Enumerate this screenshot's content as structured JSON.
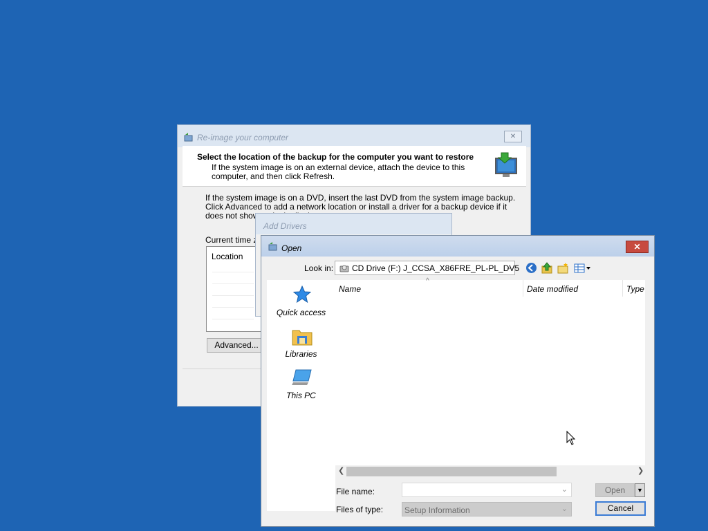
{
  "reimage": {
    "title": "Re-image your computer",
    "close_glyph": "✕",
    "header_title": "Select the location of the backup for the computer you want to restore",
    "header_sub": "If the system image is on an external device, attach the device to this computer, and then click Refresh.",
    "body_text": "If the system image is on a DVD, insert the last DVD from the system image backup. Click Advanced to add a network location or install a driver for a backup device if it does not show up in the list be",
    "time_zone_label": "Current time zo",
    "list_column": "Location",
    "advanced_button": "Advanced..."
  },
  "add_drivers": {
    "title": "Add Drivers"
  },
  "open_dialog": {
    "title": "Open",
    "close_glyph": "✕",
    "look_in_label": "Look in:",
    "look_in_value": "CD Drive (F:) J_CCSA_X86FRE_PL-PL_DV5",
    "places": [
      {
        "label": "Quick access",
        "icon": "star-icon"
      },
      {
        "label": "Libraries",
        "icon": "libraries-icon"
      },
      {
        "label": "This PC",
        "icon": "computer-icon"
      }
    ],
    "columns": [
      "Name",
      "Date modified",
      "Type"
    ],
    "file_name_label": "File name:",
    "file_name_value": "",
    "files_of_type_label": "Files of type:",
    "files_of_type_value": "Setup Information",
    "open_button": "Open",
    "cancel_button": "Cancel"
  },
  "colors": {
    "desktop": "#1e64b4",
    "close_red": "#c74a3f",
    "focus_blue": "#3a7bd5"
  }
}
